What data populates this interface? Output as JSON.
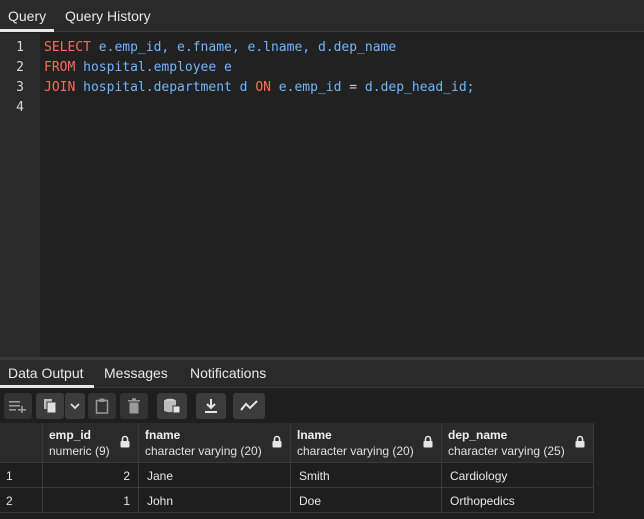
{
  "query_tabs": [
    "Query",
    "Query History"
  ],
  "editor": {
    "line_numbers": [
      "1",
      "2",
      "3",
      "4"
    ],
    "line1": {
      "k1": "SELECT",
      "t1": " e.emp_id, e.fname, e.lname, d.dep_name"
    },
    "line2": {
      "k1": "FROM",
      "t1": " hospital.employee e"
    },
    "line3": {
      "k1": "JOIN",
      "t1": " hospital.department d ",
      "k2": "ON",
      "t2": " e.emp_id ",
      "op": "=",
      "t3": " d.dep_head_id;"
    }
  },
  "result_tabs": [
    "Data Output",
    "Messages",
    "Notifications"
  ],
  "toolbar_icons": [
    "add-row-icon",
    "copy-icon",
    "dropdown-icon",
    "paste-icon",
    "delete-icon",
    "save-data-icon",
    "download-icon",
    "graph-icon"
  ],
  "grid": {
    "columns": [
      {
        "name": "emp_id",
        "type": "numeric (9)"
      },
      {
        "name": "fname",
        "type": "character varying (20)"
      },
      {
        "name": "lname",
        "type": "character varying (20)"
      },
      {
        "name": "dep_name",
        "type": "character varying (25)"
      }
    ],
    "rows": [
      {
        "num": "1",
        "emp_id": "2",
        "fname": "Jane",
        "lname": "Smith",
        "dep_name": "Cardiology"
      },
      {
        "num": "2",
        "emp_id": "1",
        "fname": "John",
        "lname": "Doe",
        "dep_name": "Orthopedics"
      }
    ]
  },
  "colors": {
    "keyword": "#ff6b5b",
    "identifier": "#6fb6ff",
    "background": "#1e1e1e"
  }
}
